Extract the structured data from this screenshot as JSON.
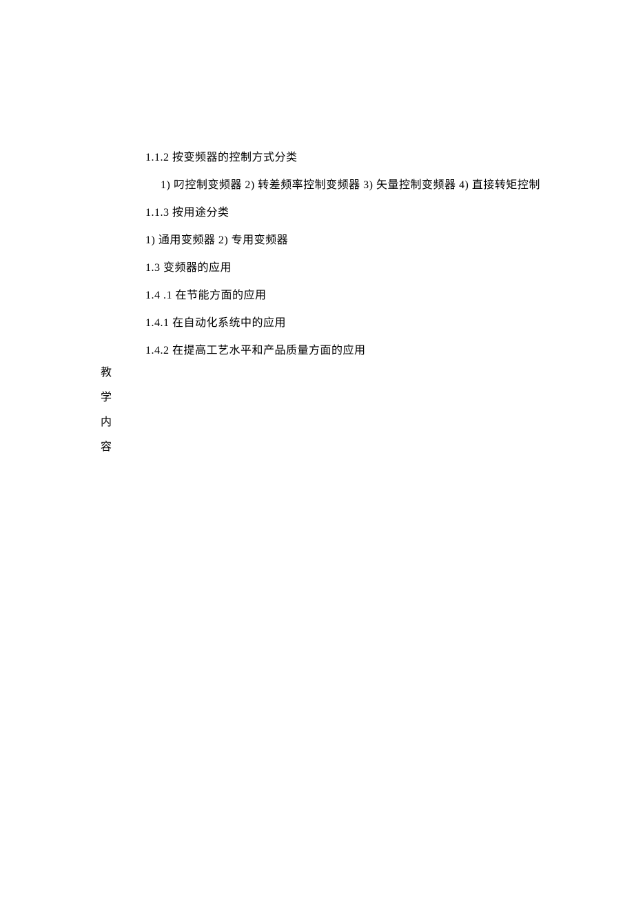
{
  "content": {
    "line1": "1.1.2  按变频器的控制方式分类",
    "line2": "1)  叼控制变频器 2)  转差频率控制变频器 3)  矢量控制变频器 4)  直接转矩控制",
    "line3": "1.1.3  按用途分类",
    "line4": "1)  通用变频器 2)  专用变频器",
    "line5": "1.3     变频器的应用",
    "line6": "1.4     .1 在节能方面的应用",
    "line7": "1.4.1  在自动化系统中的应用",
    "line8": "1.4.2  在提高工艺水平和产品质量方面的应用"
  },
  "vertical": {
    "char1": "教",
    "char2": "学",
    "char3": "内",
    "char4": "容"
  }
}
